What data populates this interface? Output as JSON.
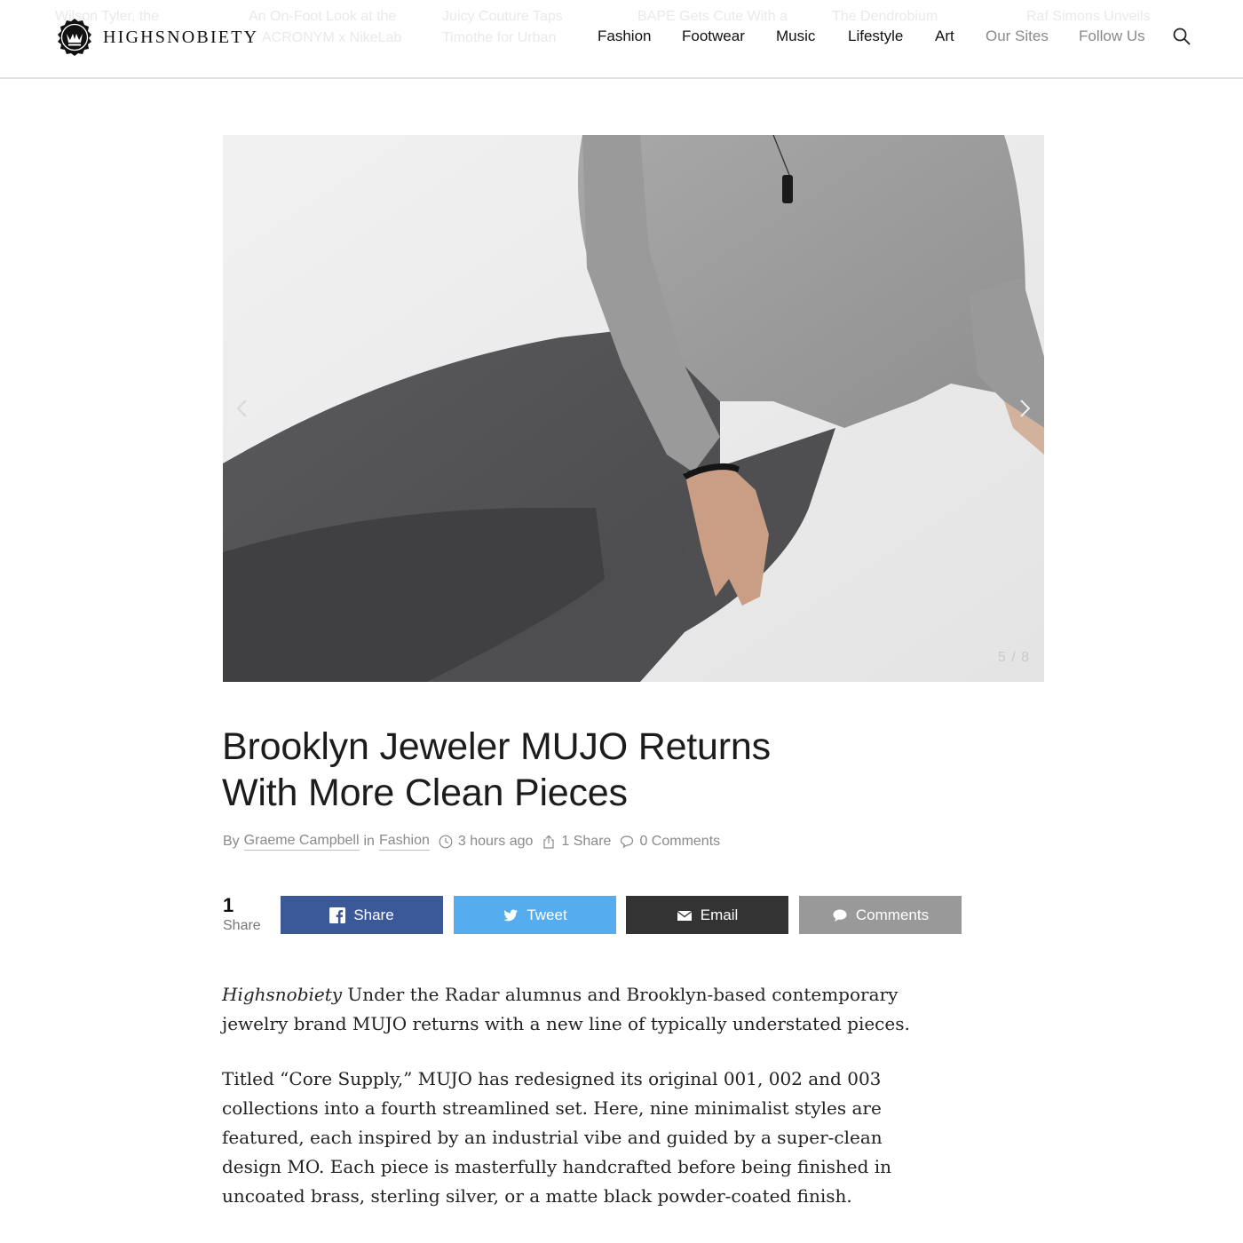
{
  "header": {
    "logo_text": "HIGHSNOBIETY",
    "ghost_headlines": [
      "Wilson Tyler, the",
      "An On-Foot Look at the",
      "ACRONYM x NikeLab",
      "Juicy Couture Taps",
      "Timothe for Urban",
      "BAPE Gets Cute With a",
      "The Dendrobium",
      "Raf Simons Unveils"
    ],
    "nav": [
      "Fashion",
      "Footwear",
      "Music",
      "Lifestyle",
      "Art",
      "Our Sites",
      "Follow Us"
    ],
    "search_icon": "search-icon"
  },
  "hero": {
    "counter": "5 / 8",
    "prev_icon": "chevron-left-icon",
    "next_icon": "chevron-right-icon"
  },
  "article": {
    "title_line1": "Brooklyn Jeweler MUJO Returns",
    "title_line2": "With More Clean Pieces",
    "meta": {
      "by": "By",
      "author": "Graeme Campbell",
      "in": "in",
      "category": "Fashion",
      "time": "3 hours ago",
      "shares": "1 Share",
      "comments": "0 Comments"
    },
    "share_count": "1",
    "share_word": "Share",
    "buttons": {
      "facebook": "Share",
      "twitter": "Tweet",
      "email": "Email",
      "comments": "Comments"
    },
    "p1_italic": "Highsnobiety",
    "p1_rest": " Under the Radar alumnus and Brooklyn-based contemporary jewelry brand MUJO returns with a new line of typically understated pieces.",
    "p2": "Titled “Core Supply,” MUJO has redesigned its original 001, 002 and 003 collections into a fourth streamlined set. Here, nine minimalist styles are featured, each inspired by an industrial vibe and guided by a super-clean design MO. Each piece is masterfully handcrafted before being finished in uncoated brass, sterling silver, or a matte black powder-coated finish."
  },
  "colors": {
    "facebook": "#3b5998",
    "twitter": "#55acee",
    "email": "#333333",
    "comments": "#999999"
  }
}
